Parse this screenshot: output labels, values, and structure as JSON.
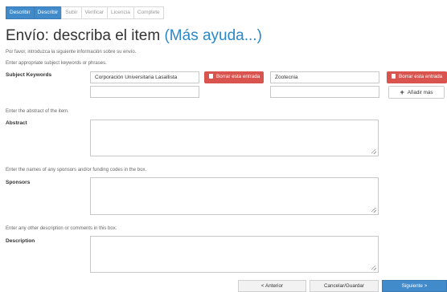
{
  "steps": [
    {
      "label": "Describir",
      "active": true
    },
    {
      "label": "Describir",
      "active": true
    },
    {
      "label": "Subir",
      "active": false
    },
    {
      "label": "Verificar",
      "active": false
    },
    {
      "label": "Licencia",
      "active": false
    },
    {
      "label": "Complete",
      "active": false
    }
  ],
  "title": {
    "main": "Envío: describa el item",
    "help": "(Más ayuda...)"
  },
  "intro": "Por favor, introduzca la siguiente información sobre su envío.",
  "keywords": {
    "hint": "Enter appropriate subject keywords or phrases.",
    "label": "Subject Keywords",
    "value1": "Corporación Universitaria Lasallista",
    "value2": "Zootecnia",
    "value3": "",
    "value4": "",
    "delete_label": "Borrar esta entrada",
    "add_label": "Añadir más"
  },
  "abstract": {
    "hint": "Enter the abstract of the item.",
    "label": "Abstract"
  },
  "sponsors": {
    "hint": "Enter the names of any sponsors and/or funding codes in the box.",
    "label": "Sponsors"
  },
  "description": {
    "hint": "Enter any other description or comments in this box.",
    "label": "Description"
  },
  "nav": {
    "previous": "< Anterior",
    "cancel": "Cancelar/Guardar",
    "next": "Siguiente >"
  },
  "colors": {
    "primary": "#428bca",
    "danger": "#d9534f",
    "link": "#2a88c9"
  }
}
